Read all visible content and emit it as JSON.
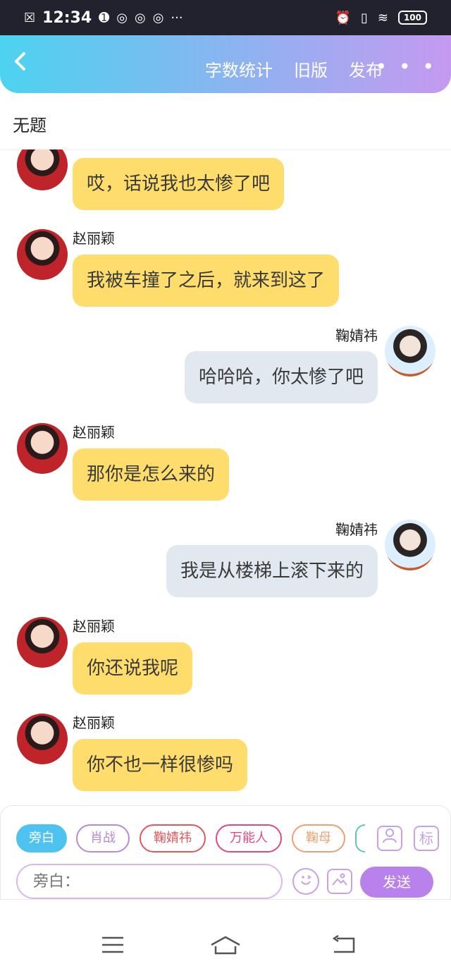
{
  "status": {
    "time": "12:34",
    "battery": "100"
  },
  "header": {
    "back_icon": "chevron-left-icon",
    "word_count": "字数统计",
    "old_version": "旧版",
    "publish": "发布",
    "more": "• • •"
  },
  "title": "无题",
  "messages": [
    {
      "side": "left",
      "name": "",
      "text": "哎，话说我也太惨了吧"
    },
    {
      "side": "left",
      "name": "赵丽颖",
      "text": "我被车撞了之后，就来到这了"
    },
    {
      "side": "right",
      "name": "鞠婧祎",
      "text": "哈哈哈，你太惨了吧"
    },
    {
      "side": "left",
      "name": "赵丽颖",
      "text": "那你是怎么来的"
    },
    {
      "side": "right",
      "name": "鞠婧祎",
      "text": "我是从楼梯上滚下来的"
    },
    {
      "side": "left",
      "name": "赵丽颖",
      "text": "你还说我呢"
    },
    {
      "side": "left",
      "name": "赵丽颖",
      "text": "你不也一样很惨吗"
    }
  ],
  "chips": [
    {
      "label": "旁白",
      "color": "#4fc3ef",
      "active": true
    },
    {
      "label": "肖战",
      "color": "#b58ad9"
    },
    {
      "label": "鞠婧祎",
      "color": "#e2585a"
    },
    {
      "label": "万能人",
      "color": "#e04a7a"
    },
    {
      "label": "鞠母",
      "color": "#f0a070"
    }
  ],
  "tools": {
    "mark_label": "标"
  },
  "input": {
    "placeholder": "旁白："
  },
  "send_label": "发送"
}
